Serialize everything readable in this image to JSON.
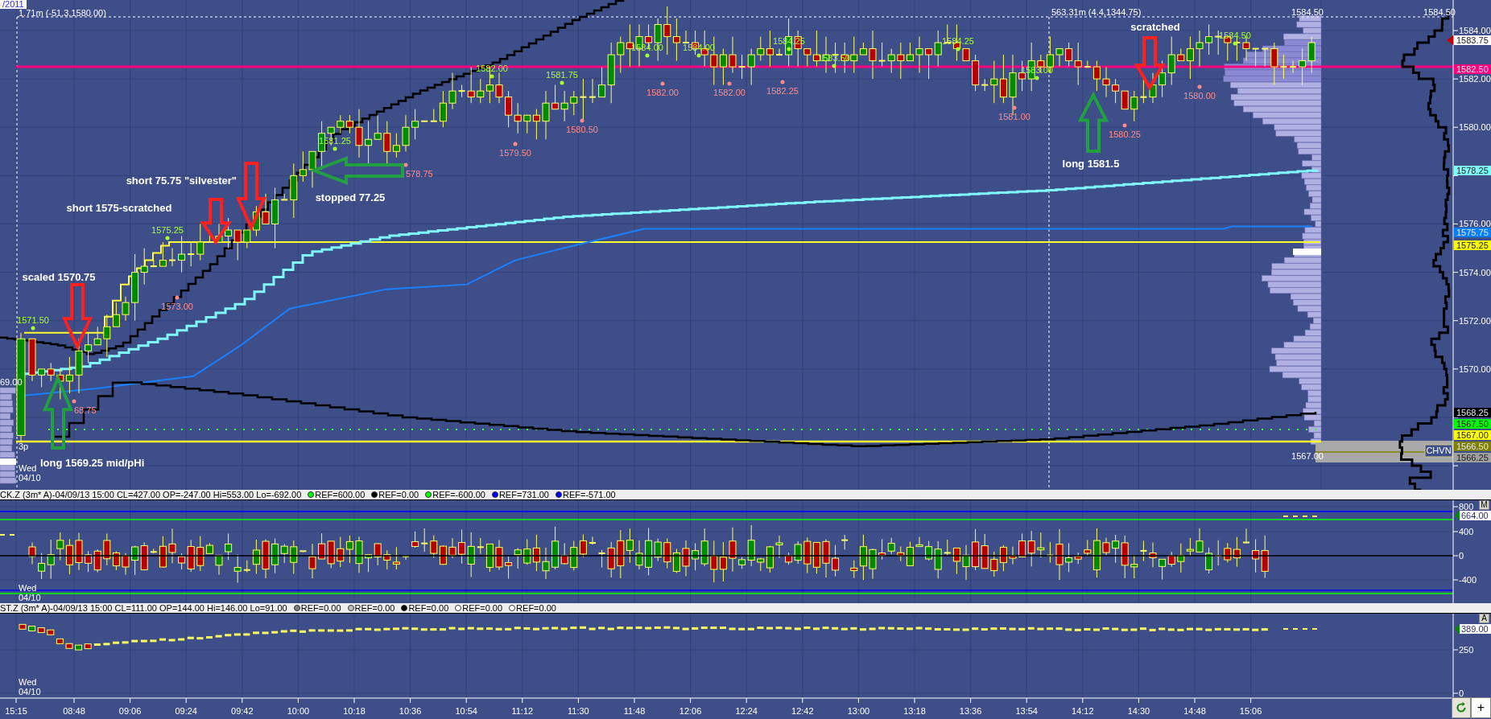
{
  "date_tag": "/2011",
  "main_chart": {
    "cursor_readouts": [
      "1.71m (-51.3,1580.00)",
      "563.31m (4.4,1344.75)"
    ],
    "high_labels": [
      "1571.50",
      "1575.25",
      "1581.25",
      "1582.00",
      "1581.75",
      "1584.00",
      "1584.00",
      "1584.25",
      "1583.50",
      "1584.25",
      "1583.00",
      "1584.50"
    ],
    "low_labels": [
      "68.75",
      "1573.00",
      "578.75",
      "1579.50",
      "1580.50",
      "1582.00",
      "1582.00",
      "1582.25",
      "1581.00",
      "1580.25",
      "1580.00"
    ],
    "annotations": [
      {
        "text": "scratched"
      },
      {
        "text": "long 1581.5"
      },
      {
        "text": "short 75.75 \"silvester\""
      },
      {
        "text": "stopped 77.25"
      },
      {
        "text": "short 1575-scratched"
      },
      {
        "text": "scaled 1570.75"
      },
      {
        "text": "long 1569.25 mid/pHi"
      }
    ],
    "arrows": [
      {
        "kind": "down"
      },
      {
        "kind": "up"
      },
      {
        "kind": "down"
      },
      {
        "kind": "left"
      },
      {
        "kind": "down"
      },
      {
        "kind": "down"
      },
      {
        "kind": "up"
      }
    ],
    "profile_labels": [
      "1584.50",
      "1567.00"
    ],
    "left_price": "69.00",
    "session": "3p",
    "day": "Wed",
    "date": "04/10",
    "band_label": "CHVN"
  },
  "price_axis": {
    "top_label": "1584.50",
    "ticks": [
      "1584.00",
      "1582.00",
      "1580.00",
      "1576.00",
      "1574.00",
      "1572.00",
      "1570.00"
    ],
    "tags": [
      {
        "text": "1583.75",
        "color": "#ffffff"
      },
      {
        "text": "1582.50",
        "color": "#ff0080"
      },
      {
        "text": "1578.25",
        "color": "#80ffff"
      },
      {
        "text": "1575.75",
        "color": "#0080ff"
      },
      {
        "text": "1575.25",
        "color": "#ffff00"
      },
      {
        "text": "1568.25",
        "color": "#000000"
      },
      {
        "text": "1567.50",
        "color": "#00ff00"
      },
      {
        "text": "1567.00",
        "color": "#ffff00"
      },
      {
        "text": "1566.50",
        "color": "#808000"
      },
      {
        "text": "1566.25",
        "color": "#a0a0a0"
      }
    ]
  },
  "panels": [
    {
      "header": "CK.Z (3m* A)-04/09/13 15:00 CL=427.00 OP=-247.00 Hi=553.00 Lo=-692.00",
      "refs": [
        {
          "text": "REF=600.00",
          "color": "#00ff00"
        },
        {
          "text": "REF=0.00",
          "color": "#000000"
        },
        {
          "text": "REF=-600.00",
          "color": "#00ff00"
        },
        {
          "text": "REF=731.00",
          "color": "#0000ff"
        },
        {
          "text": "REF=-571.00",
          "color": "#0000ff"
        }
      ],
      "axis_ticks": [
        "800",
        "400",
        "0",
        "-400"
      ],
      "tag": "664.00",
      "mode_button": "M",
      "day": "Wed",
      "date": "04/10"
    },
    {
      "header": "ST.Z (3m* A)-04/09/13 15:00 CL=111.00 OP=144.00 Hi=146.00 Lo=91.00",
      "refs": [
        {
          "text": "REF=0.00",
          "color": "#808080"
        },
        {
          "text": "REF=0.00",
          "color": "#c0c0c0"
        },
        {
          "text": "REF=0.00",
          "color": "#000000"
        },
        {
          "text": "REF=0.00",
          "color": "#ffffff"
        },
        {
          "text": "REF=0.00",
          "color": "#ffffff"
        }
      ],
      "axis_ticks": [
        "250",
        "0"
      ],
      "tag": "389.00",
      "mode_button": "A",
      "day": "Wed",
      "date": "04/10"
    }
  ],
  "time_axis": [
    "15:15",
    "08:48",
    "09:06",
    "09:24",
    "09:42",
    "10:00",
    "10:18",
    "10:36",
    "10:54",
    "11:12",
    "11:30",
    "11:48",
    "12:06",
    "12:24",
    "12:42",
    "13:00",
    "13:18",
    "13:36",
    "13:54",
    "14:12",
    "14:30",
    "14:48",
    "15:06"
  ],
  "buttons": [
    {
      "kind": "refresh"
    },
    {
      "kind": "add",
      "label": "+"
    }
  ]
}
